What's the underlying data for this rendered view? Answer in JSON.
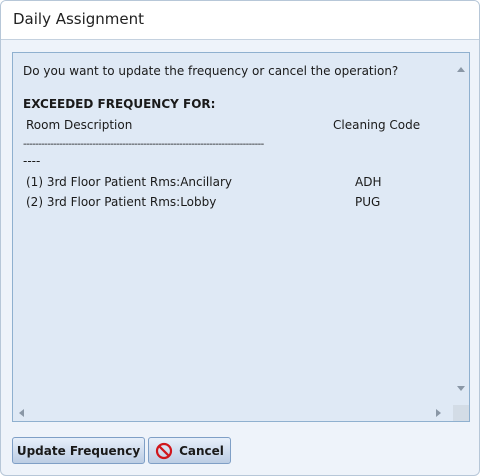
{
  "window": {
    "title": "Daily Assignment"
  },
  "message": {
    "question": "Do you want to update the frequency or cancel the operation?",
    "heading": "EXCEEDED FREQUENCY FOR:",
    "columns": [
      "Room Description",
      "Cleaning Code"
    ],
    "separator": "--------------------------------------------------------------------------------",
    "separator_tail": "----",
    "rows": [
      {
        "room": "(1) 3rd Floor Patient Rms:Ancillary",
        "code": "ADH"
      },
      {
        "room": "(2) 3rd Floor Patient Rms:Lobby",
        "code": "PUG"
      }
    ]
  },
  "buttons": {
    "update": "Update Frequency",
    "cancel": "Cancel"
  },
  "icons": {
    "cancel": "cancel-circle-icon"
  },
  "colors": {
    "cancel_icon": "#d0161c",
    "panel_bg": "#dfe9f5",
    "button_border": "#7f9fc6"
  }
}
